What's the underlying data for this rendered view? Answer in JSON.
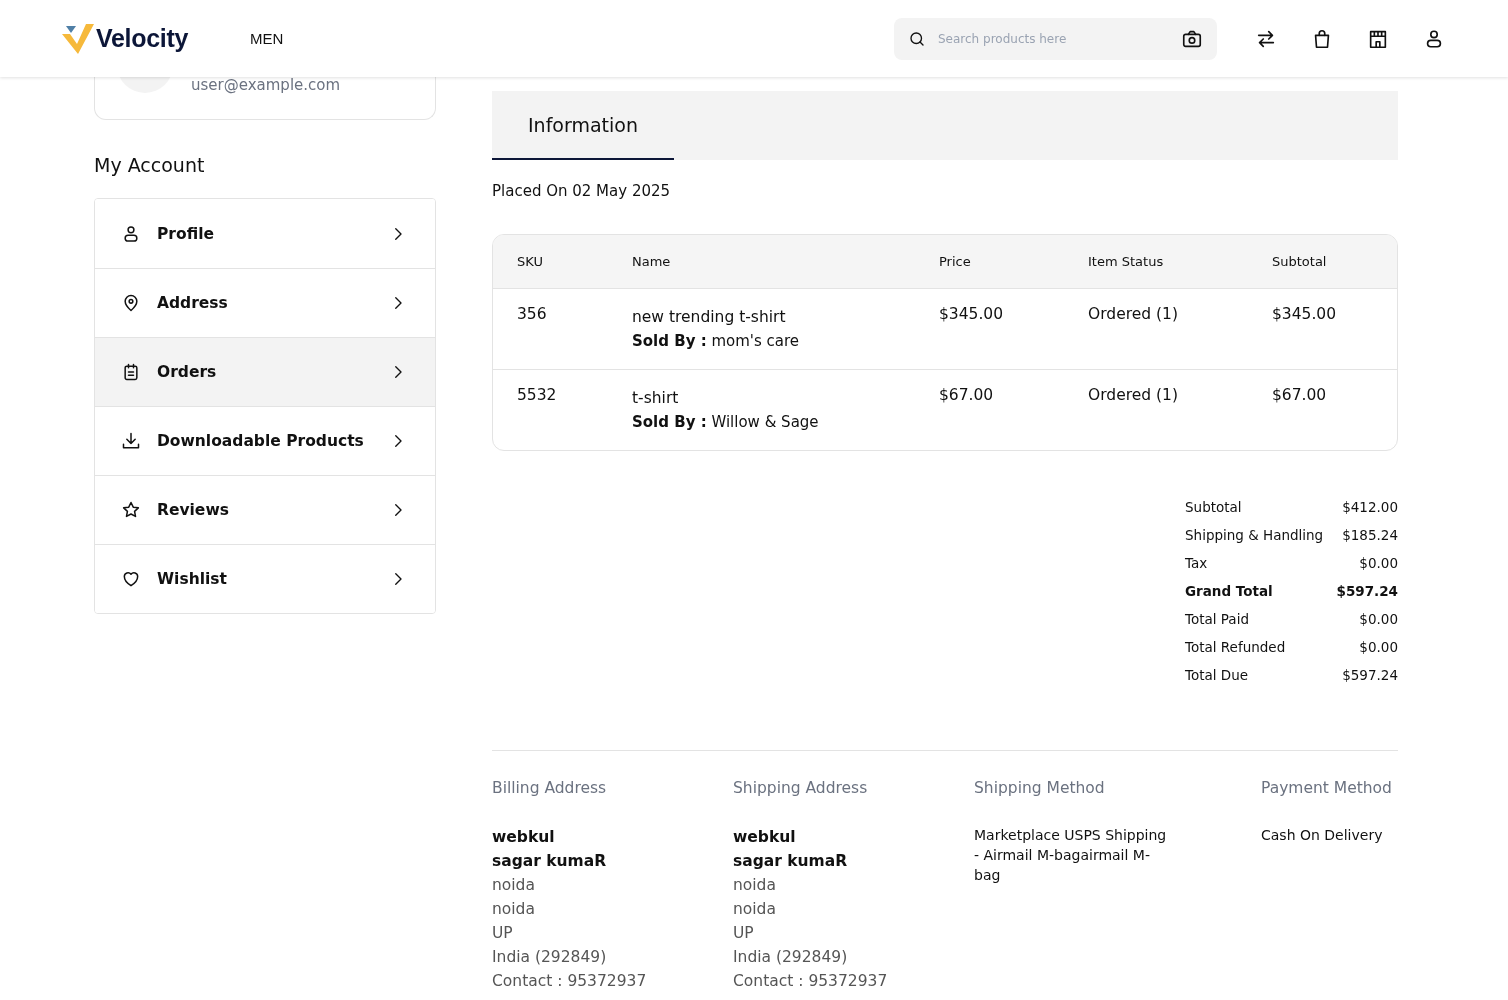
{
  "header": {
    "logo": "Velocity",
    "nav": [
      "MEN"
    ],
    "search": {
      "placeholder": "Search products here"
    }
  },
  "account_card": {
    "email": "user@example.com"
  },
  "sidebar": {
    "title": "My Account",
    "items": [
      {
        "label": "Profile",
        "kind": "person",
        "selected": false
      },
      {
        "label": "Address",
        "kind": "pin",
        "selected": false
      },
      {
        "label": "Orders",
        "kind": "clipboard",
        "selected": true
      },
      {
        "label": "Downloadable Products",
        "kind": "download",
        "selected": false
      },
      {
        "label": "Reviews",
        "kind": "star",
        "selected": false
      },
      {
        "label": "Wishlist",
        "kind": "heart",
        "selected": false
      }
    ]
  },
  "tabs": [
    {
      "label": "Information",
      "selected": true
    }
  ],
  "placed_on": "Placed On 02 May 2025",
  "table": {
    "columns": [
      "SKU",
      "Name",
      "Price",
      "Item Status",
      "Subtotal"
    ],
    "rows": [
      {
        "sku": "356",
        "name": "new trending t-shirt",
        "sold_by_label": "Sold By :",
        "sold_by": "mom's care",
        "price": "$345.00",
        "status": "Ordered (1)",
        "subtotal": "$345.00"
      },
      {
        "sku": "5532",
        "name": "t-shirt",
        "sold_by_label": "Sold By :",
        "sold_by": "Willow & Sage",
        "price": "$67.00",
        "status": "Ordered (1)",
        "subtotal": "$67.00"
      }
    ]
  },
  "totals": [
    {
      "label": "Subtotal",
      "value": "$412.00",
      "bold": false
    },
    {
      "label": "Shipping & Handling",
      "value": "$185.24",
      "bold": false
    },
    {
      "label": "Tax",
      "value": "$0.00",
      "bold": false
    },
    {
      "label": "Grand Total",
      "value": "$597.24",
      "bold": true
    },
    {
      "label": "Total Paid",
      "value": "$0.00",
      "bold": false
    },
    {
      "label": "Total Refunded",
      "value": "$0.00",
      "bold": false
    },
    {
      "label": "Total Due",
      "value": "$597.24",
      "bold": false
    }
  ],
  "info": [
    {
      "kind": "address",
      "title": "Billing Address",
      "company": "webkul",
      "name": "sagar kumaR",
      "lines": [
        "noida",
        "noida",
        "UP",
        "India (292849)",
        "Contact : 95372937"
      ]
    },
    {
      "kind": "address",
      "title": "Shipping Address",
      "company": "webkul",
      "name": "sagar kumaR",
      "lines": [
        "noida",
        "noida",
        "UP",
        "India (292849)",
        "Contact : 95372937"
      ]
    },
    {
      "kind": "text",
      "title": "Shipping Method",
      "text": "Marketplace USPS Shipping - Airmail M-bagairmail M-bag"
    },
    {
      "kind": "text",
      "title": "Payment Method",
      "text": "Cash On Delivery"
    }
  ]
}
